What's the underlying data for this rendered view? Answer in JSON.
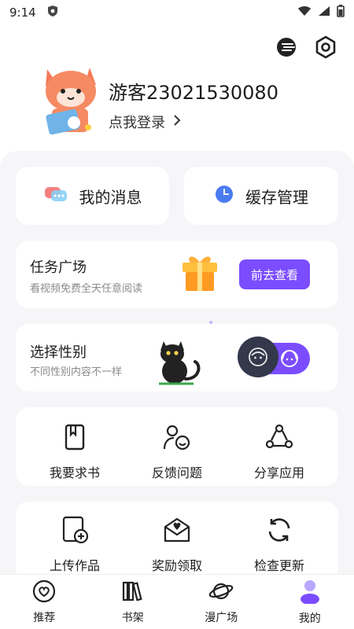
{
  "statusbar": {
    "time": "9:14"
  },
  "profile": {
    "username": "游客23021530080",
    "login_text": "点我登录"
  },
  "cards": {
    "messages": {
      "label": "我的消息"
    },
    "cache": {
      "label": "缓存管理"
    },
    "tasks": {
      "title": "任务广场",
      "subtitle": "看视频免费全天任意阅读",
      "button": "前去查看"
    },
    "gender": {
      "title": "选择性别",
      "subtitle": "不同性别内容不一样"
    }
  },
  "grid1": [
    {
      "label": "我要求书",
      "icon": "book-icon"
    },
    {
      "label": "反馈问题",
      "icon": "feedback-icon"
    },
    {
      "label": "分享应用",
      "icon": "share-icon"
    }
  ],
  "grid2": [
    {
      "label": "上传作品",
      "icon": "upload-icon"
    },
    {
      "label": "奖励领取",
      "icon": "reward-icon"
    },
    {
      "label": "检查更新",
      "icon": "refresh-icon"
    }
  ],
  "nav": [
    {
      "label": "推荐",
      "icon": "heart-icon"
    },
    {
      "label": "书架",
      "icon": "bookshelf-icon"
    },
    {
      "label": "漫广场",
      "icon": "planet-icon"
    },
    {
      "label": "我的",
      "icon": "profile-icon",
      "active": true
    }
  ],
  "colors": {
    "accent": "#7b4dff",
    "panel": "#f6f5f8"
  }
}
